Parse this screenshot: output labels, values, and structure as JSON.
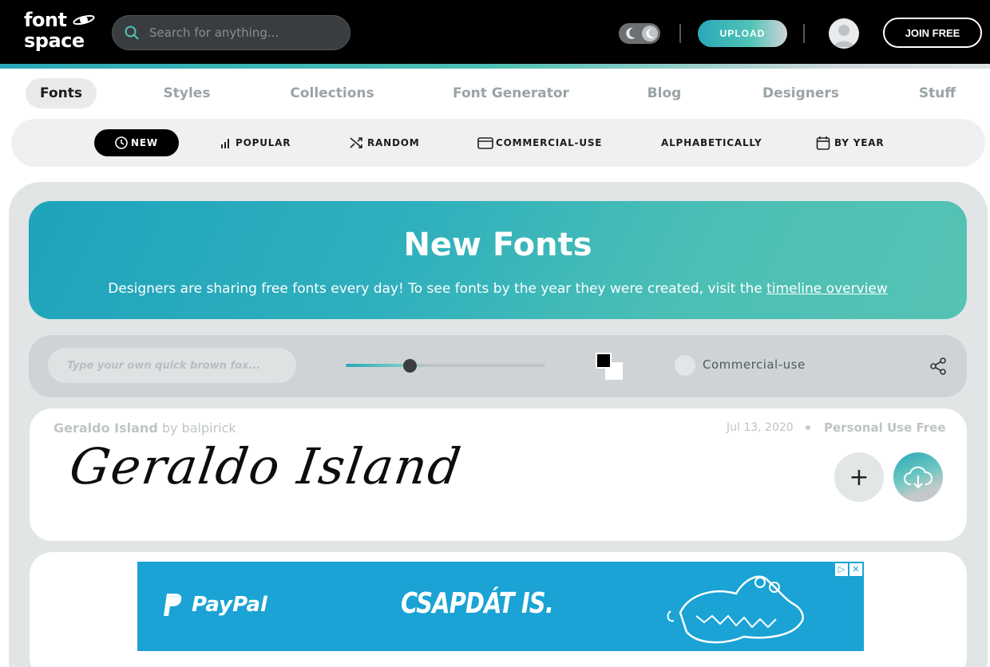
{
  "header": {
    "logo_line1": "font",
    "logo_line2": "space",
    "search_placeholder": "Search for anything...",
    "upload_label": "UPLOAD",
    "join_label": "JOIN FREE"
  },
  "nav": {
    "items": [
      {
        "label": "Fonts"
      },
      {
        "label": "Styles"
      },
      {
        "label": "Collections"
      },
      {
        "label": "Font Generator"
      },
      {
        "label": "Blog"
      },
      {
        "label": "Designers"
      },
      {
        "label": "Stuff"
      }
    ]
  },
  "sort": {
    "items": [
      {
        "label": "NEW",
        "icon": "clock-icon"
      },
      {
        "label": "POPULAR",
        "icon": "bar-chart-icon"
      },
      {
        "label": "RANDOM",
        "icon": "shuffle-icon"
      },
      {
        "label": "COMMERCIAL-USE",
        "icon": "credit-card-icon"
      },
      {
        "label": "ALPHABETICALLY",
        "icon": ""
      },
      {
        "label": "BY YEAR",
        "icon": "calendar-icon"
      }
    ]
  },
  "hero": {
    "title": "New Fonts",
    "description": "Designers are sharing free fonts every day! To see fonts by the year they were created, visit the ",
    "link_text": "timeline overview"
  },
  "toolbar": {
    "preview_placeholder": "Type your own quick brown fox...",
    "commercial_label": "Commercial-use"
  },
  "font_card": {
    "name": "Geraldo Island",
    "by": "by",
    "designer": "balpirick",
    "date": "Jul 13, 2020",
    "license": "Personal Use Free",
    "preview_text": "Geraldo Island",
    "add_label": "+"
  },
  "ad": {
    "brand": "PayPal",
    "text": "CSAPDÁT IS."
  },
  "colors": {
    "accent": "#2aa8b8",
    "accent2": "#55c3b3",
    "header_bg": "#000000",
    "ad_bg": "#1aa3d4"
  }
}
